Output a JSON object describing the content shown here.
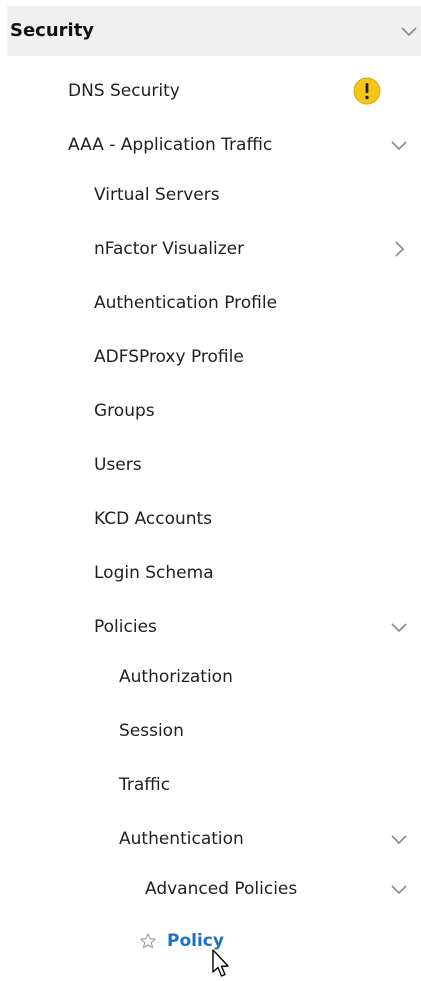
{
  "nav": {
    "security": {
      "label": "Security"
    },
    "dns_security": {
      "label": "DNS Security"
    },
    "aaa": {
      "label": "AAA - Application Traffic"
    },
    "virtual_servers": {
      "label": "Virtual Servers"
    },
    "nfactor": {
      "label": "nFactor Visualizer"
    },
    "auth_profile": {
      "label": "Authentication Profile"
    },
    "adfs_proxy": {
      "label": "ADFSProxy Profile"
    },
    "groups": {
      "label": "Groups"
    },
    "users": {
      "label": "Users"
    },
    "kcd": {
      "label": "KCD Accounts"
    },
    "login_schema": {
      "label": "Login Schema"
    },
    "policies": {
      "label": "Policies"
    },
    "authorization": {
      "label": "Authorization"
    },
    "session": {
      "label": "Session"
    },
    "traffic": {
      "label": "Traffic"
    },
    "authentication": {
      "label": "Authentication"
    },
    "advanced_policies": {
      "label": "Advanced Policies"
    },
    "policy": {
      "label": "Policy"
    }
  },
  "icons": {
    "chevron_down": "chevron-down-icon",
    "chevron_right": "chevron-right-icon",
    "warning": "warning-icon",
    "star": "star-icon",
    "cursor": "mouse-cursor-icon"
  },
  "colors": {
    "header_bg": "#f0f0f0",
    "active_link": "#1a73c9",
    "warning_fill": "#f5c518",
    "chevron": "#8a8a8a"
  }
}
